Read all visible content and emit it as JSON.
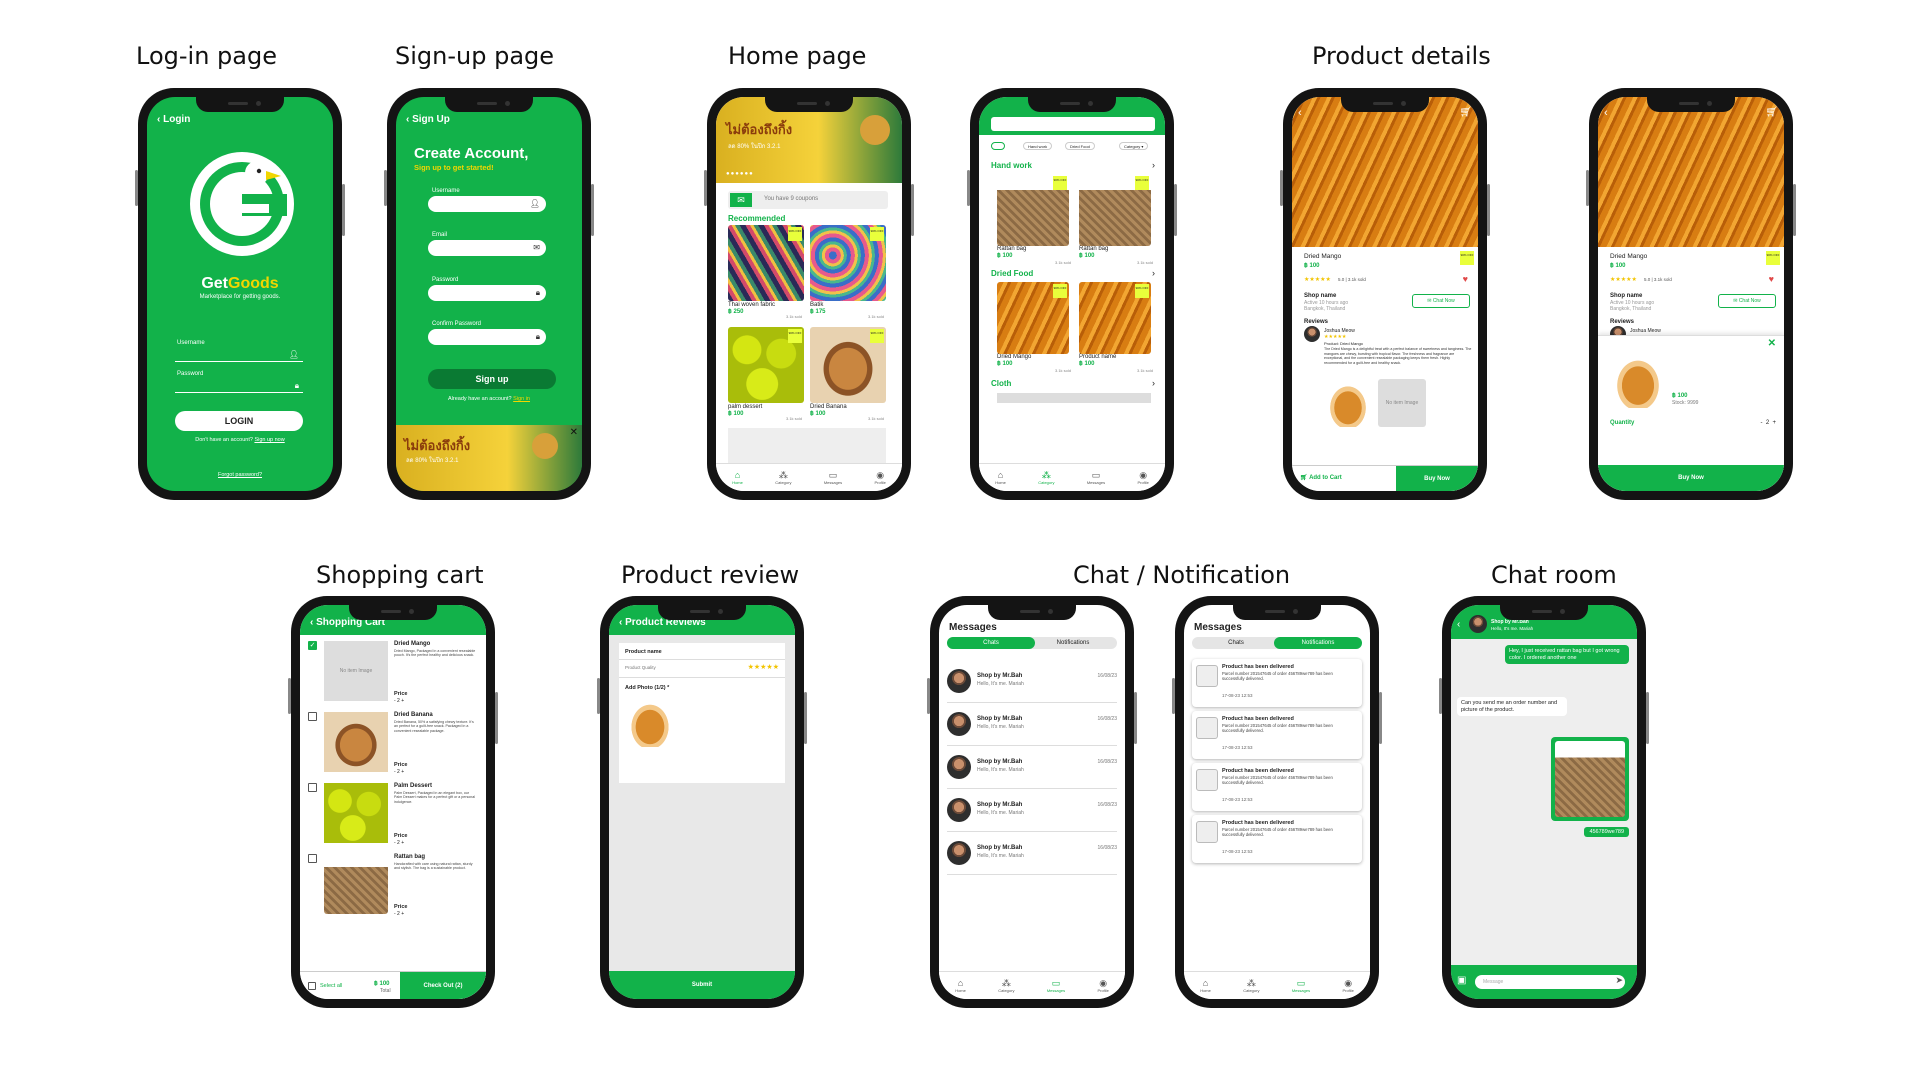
{
  "titles": {
    "login": "Log-in page",
    "signup": "Sign-up page",
    "home": "Home page",
    "details": "Product details",
    "cart": "Shopping cart",
    "review": "Product review",
    "chat": "Chat / Notification",
    "chatroom": "Chat room"
  },
  "colors": {
    "brand": "#12b24a",
    "accent": "#f2d600",
    "tag": "#e9ff3b"
  },
  "login": {
    "header": "Login",
    "brand_get": "Get",
    "brand_goods": "Goods",
    "tagline": "Marketplace for getting goods.",
    "username_label": "Username",
    "password_label": "Password",
    "button": "LOGIN",
    "no_account": "Don't have an account?",
    "signup_link": "Sign up now",
    "forgot": "Forgot password?"
  },
  "signup": {
    "header": "Sign Up",
    "title": "Create Account,",
    "subtitle": "Sign up to get started!",
    "username": "Username",
    "email": "Email",
    "password": "Password",
    "confirm": "Confirm Password",
    "button": "Sign up",
    "have_account": "Already have an account?",
    "signin_link": "Sign in",
    "banner_text": "ไม่ต้องถึงกิ้ง",
    "banner_sub": "ลด 80% ในปีก 3.2.1"
  },
  "home": {
    "banner_text": "ไม่ต้องถึงกิ้ง",
    "banner_sub": "ลด 80% ในปีก 3.2.1",
    "coupon": "You have 9 coupons",
    "recommended": "Recommended",
    "products": [
      {
        "name": "Thai woven fabric",
        "price": "฿ 250",
        "sold": "3.1k sold"
      },
      {
        "name": "Batik",
        "price": "฿ 175",
        "sold": "3.1k sold"
      },
      {
        "name": "palm dessert",
        "price": "฿ 100",
        "sold": "3.1k sold"
      },
      {
        "name": "Dried Banana",
        "price": "฿ 100",
        "sold": "3.1k sold"
      }
    ],
    "nav": [
      "Home",
      "Category",
      "Messages",
      "Profile"
    ]
  },
  "category": {
    "chips": [
      "All",
      "Hand work",
      "Dried Food",
      "Category"
    ],
    "handwork": "Hand work",
    "driedfood": "Dried Food",
    "cloth": "Cloth",
    "products": [
      {
        "name": "Rattan bag",
        "price": "฿ 100",
        "sold": "3.1k sold"
      },
      {
        "name": "Rattan bag",
        "price": "฿ 100",
        "sold": "3.1k sold"
      },
      {
        "name": "Dried Mango",
        "price": "฿ 100",
        "sold": "3.1k sold"
      },
      {
        "name": "Product name",
        "price": "฿ 100",
        "sold": "3.1k sold"
      }
    ]
  },
  "details": {
    "name": "Dried Mango",
    "price": "฿ 100",
    "rating": "5.0 | 3.1k sold",
    "shop": "Shop name",
    "shop_sub": "Active 10 hours ago",
    "location": "Bangkok, Thailand",
    "chat": "Chat Now",
    "reviews": "Reviews",
    "reviewer": "Joshua Meow",
    "review_product": "Product: Dried Mango",
    "review_text": "The Dried Mango is a delightful treat with a perfect balance of sweetness and tanginess. The mangoes are chewy, bursting with tropical flavor. The freshness and fragrance are exceptional, and the convenient resealable packaging keeps them fresh. Highly recommended for a guilt-free and healthy snack.",
    "no_image": "No item Image",
    "add_cart": "Add to Cart",
    "buy": "Buy Now",
    "sheet_price": "฿ 100",
    "stock": "Stock: 9999",
    "quantity": "Quantity",
    "qty": "2"
  },
  "cart": {
    "header": "Shopping Cart",
    "items": [
      {
        "name": "Dried Mango",
        "desc": "Dried Mango, Packaged in a convenient resealable pouch. It's the perfect healthy and delicious snack.",
        "price": "Price",
        "qty": "- 2 +"
      },
      {
        "name": "Dried Banana",
        "desc": "Dried Banana, 50% a satisfying chewy texture. It's an perfect for a guilt-free snack. Packaged in a convenient resealable package.",
        "price": "Price",
        "qty": "- 2 +"
      },
      {
        "name": "Palm Dessert",
        "desc": "Palm Dessert, Packaged in an elegant box, our Palm Dessert makes for a perfect gift or a personal indulgence.",
        "price": "Price",
        "qty": "- 2 +"
      },
      {
        "name": "Rattan bag",
        "desc": "Handcrafted with care using natural rattan, sturdy and stylish. The bag is a sustainable product.",
        "price": "Price",
        "qty": "- 2 +"
      }
    ],
    "no_image": "No item Image",
    "select_all": "Select all",
    "total": "฿ 100",
    "total_label": "Total",
    "checkout": "Check Out (2)"
  },
  "review": {
    "header": "Product Reviews",
    "product": "Product name",
    "quality": "Product Quality",
    "add_photo": "Add Photo (1/2) *",
    "submit": "Submit"
  },
  "messages": {
    "title": "Messages",
    "tab_chats": "Chats",
    "tab_notif": "Notifications",
    "rows": [
      {
        "name": "Shop by Mr.Bah",
        "preview": "Hello, It's me. Mariah",
        "date": "16/08/23"
      },
      {
        "name": "Shop by Mr.Bah",
        "preview": "Hello, It's me. Mariah",
        "date": "16/08/23"
      },
      {
        "name": "Shop by Mr.Bah",
        "preview": "Hello, It's me. Mariah",
        "date": "16/08/23"
      },
      {
        "name": "Shop by Mr.Bah",
        "preview": "Hello, It's me. Mariah",
        "date": "16/08/23"
      },
      {
        "name": "Shop by Mr.Bah",
        "preview": "Hello, It's me. Mariah",
        "date": "16/08/23"
      }
    ],
    "notifs": [
      {
        "title": "Product has been delivered",
        "body": "Parcel number 201547645 of order 456789we789 has been successfully delivered.",
        "time": "17-08-23 12:53"
      },
      {
        "title": "Product has been delivered",
        "body": "Parcel number 201547645 of order 456789we789 has been successfully delivered.",
        "time": "17-08-23 12:53"
      },
      {
        "title": "Product has been delivered",
        "body": "Parcel number 201547645 of order 456789we789 has been successfully delivered.",
        "time": "17-08-23 12:53"
      },
      {
        "title": "Product has been delivered",
        "body": "Parcel number 201547645 of order 456789we789 has been successfully delivered.",
        "time": "17-08-23 12:53"
      }
    ]
  },
  "chatroom": {
    "shop": "Shop by Mr.Bah",
    "status": "Hello, It's me. Mariah",
    "msg1": "Hey, I just received rattan bag but I got wrong color. I ordered another one",
    "msg2": "Can you send me an order number and picture of the product.",
    "order": "456789we789",
    "placeholder": "Message"
  }
}
